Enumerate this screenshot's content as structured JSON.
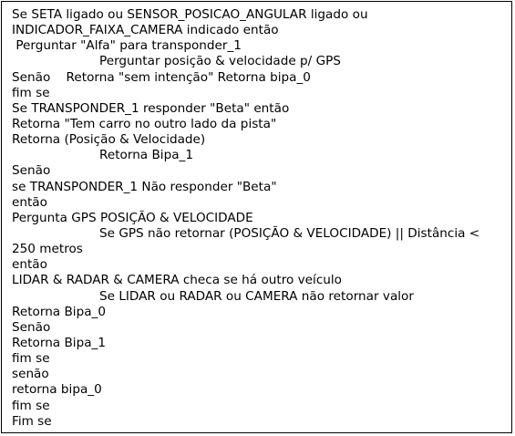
{
  "document": {
    "lines": [
      "Se SETA ligado ou SENSOR_POSICAO_ANGULAR ligado ou",
      "INDICADOR_FAIXA_CAMERA indicado então",
      " Perguntar \"Alfa\" para transponder_1",
      "Perguntar posição & velocidade p/ GPS",
      "Senão    Retorna \"sem intenção\" Retorna bipa_0",
      "fim se",
      "Se TRANSPONDER_1 responder \"Beta\" então",
      "Retorna \"Tem carro no outro lado da pista\"",
      "Retorna (Posição & Velocidade)",
      "Retorna Bipa_1",
      "Senão",
      "se TRANSPONDER_1 Não responder \"Beta\"",
      "então",
      "Pergunta GPS POSIÇÃO & VELOCIDADE",
      "Se GPS não retornar (POSIÇÃO & VELOCIDADE) || Distância <",
      "250 metros",
      "então",
      "LIDAR & RADAR & CAMERA checa se há outro veículo",
      "Se LIDAR ou RADAR ou CAMERA não retornar valor",
      "Retorna Bipa_0",
      "Senão",
      "Retorna Bipa_1",
      "fim se",
      "senão",
      "retorna bipa_0",
      "fim se",
      "Fim se"
    ]
  }
}
